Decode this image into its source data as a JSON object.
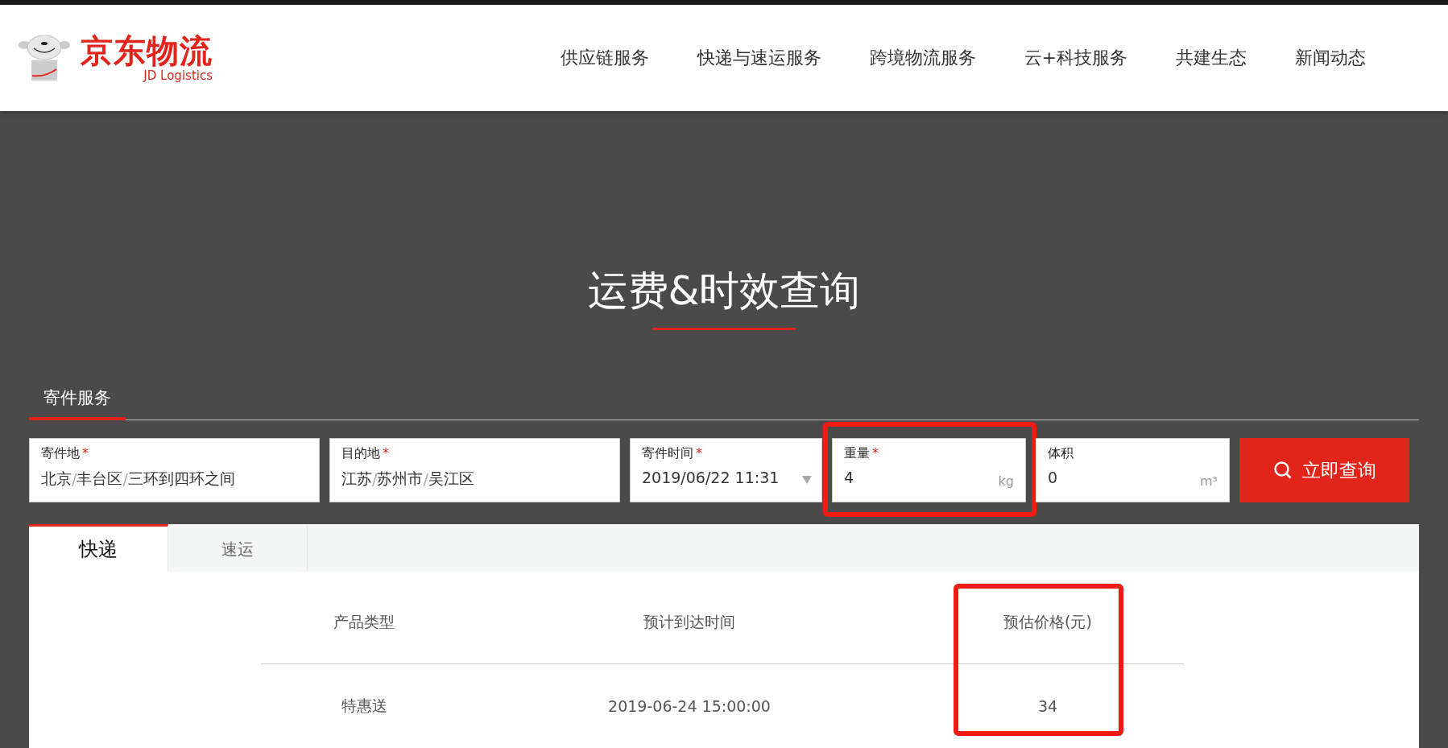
{
  "header": {
    "logo": {
      "name": "京东物流",
      "subtitle": "JD Logistics"
    },
    "nav": [
      {
        "label": "供应链服务"
      },
      {
        "label": "快递与速运服务"
      },
      {
        "label": "跨境物流服务"
      },
      {
        "label": "云+科技服务"
      },
      {
        "label": "共建生态"
      },
      {
        "label": "新闻动态"
      }
    ]
  },
  "title": "运费&时效查询",
  "section_tab": {
    "label": "寄件服务",
    "selected": true
  },
  "fields": [
    {
      "kind": "text",
      "label": "寄件地",
      "mark": "*",
      "value": [
        "北京",
        "丰台区",
        "三环到四环之间"
      ],
      "separator": "/",
      "highlighted": false
    },
    {
      "kind": "text",
      "label": "目的地",
      "mark": "*",
      "value": [
        "江苏",
        "苏州市",
        "吴江区"
      ],
      "separator": "/",
      "highlighted": false
    },
    {
      "kind": "select",
      "label": "寄件时间",
      "mark": "*",
      "value": [
        "2019/06/22 11:31"
      ],
      "highlighted": false
    },
    {
      "kind": "unit",
      "label": "重量",
      "mark": "*",
      "value": [
        "4"
      ],
      "unit": "kg",
      "highlighted": true
    },
    {
      "kind": "unit",
      "label": "体积",
      "value": [
        "0"
      ],
      "unit": "m³",
      "highlighted": false
    }
  ],
  "search_button": "立即查询",
  "tabs": [
    {
      "label": "快递",
      "selected": true
    },
    {
      "label": "速运",
      "selected": false
    }
  ],
  "table": {
    "columns": [
      {
        "label": "产品类型",
        "highlighted": false
      },
      {
        "label": "预计到达时间",
        "highlighted": false
      },
      {
        "label": "预估价格(元)",
        "highlighted": true
      }
    ],
    "rows": [
      [
        "特惠送",
        "2019-06-24 15:00:00",
        "34"
      ]
    ]
  }
}
